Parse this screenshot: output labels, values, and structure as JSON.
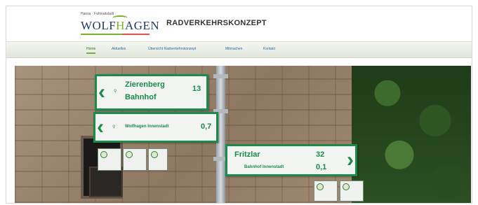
{
  "header": {
    "logo_tagline": "Hansa · Fahrradstadt",
    "logo_word_a": "WOLF",
    "logo_word_b": "H",
    "logo_word_c": "AGEN",
    "site_title": "RADVERKEHRSKONZEPT"
  },
  "nav": {
    "items": [
      {
        "label": "Home",
        "active": true
      },
      {
        "label": "Aktuelles",
        "active": false
      },
      {
        "label": "Übersicht Radverkehrskonzept",
        "active": false
      },
      {
        "label": "Mitmachen",
        "active": false
      },
      {
        "label": "Kontakt",
        "active": false
      }
    ]
  },
  "hero": {
    "signs": [
      {
        "dest": "Zierenberg",
        "sub": "Bahnhof",
        "dist": "13"
      },
      {
        "dest": "Wolfhagen Innenstadt",
        "dist": "0,7"
      },
      {
        "dest": "Fritzlar",
        "sub": "Bahnhof Innenstadt",
        "dist": "32",
        "dist2": "0,1"
      }
    ]
  },
  "colors": {
    "accent": "#7bb02d",
    "brand": "#1d3a6e",
    "sign_green": "#1c8a4a",
    "nav_link": "#2b6aa3"
  }
}
